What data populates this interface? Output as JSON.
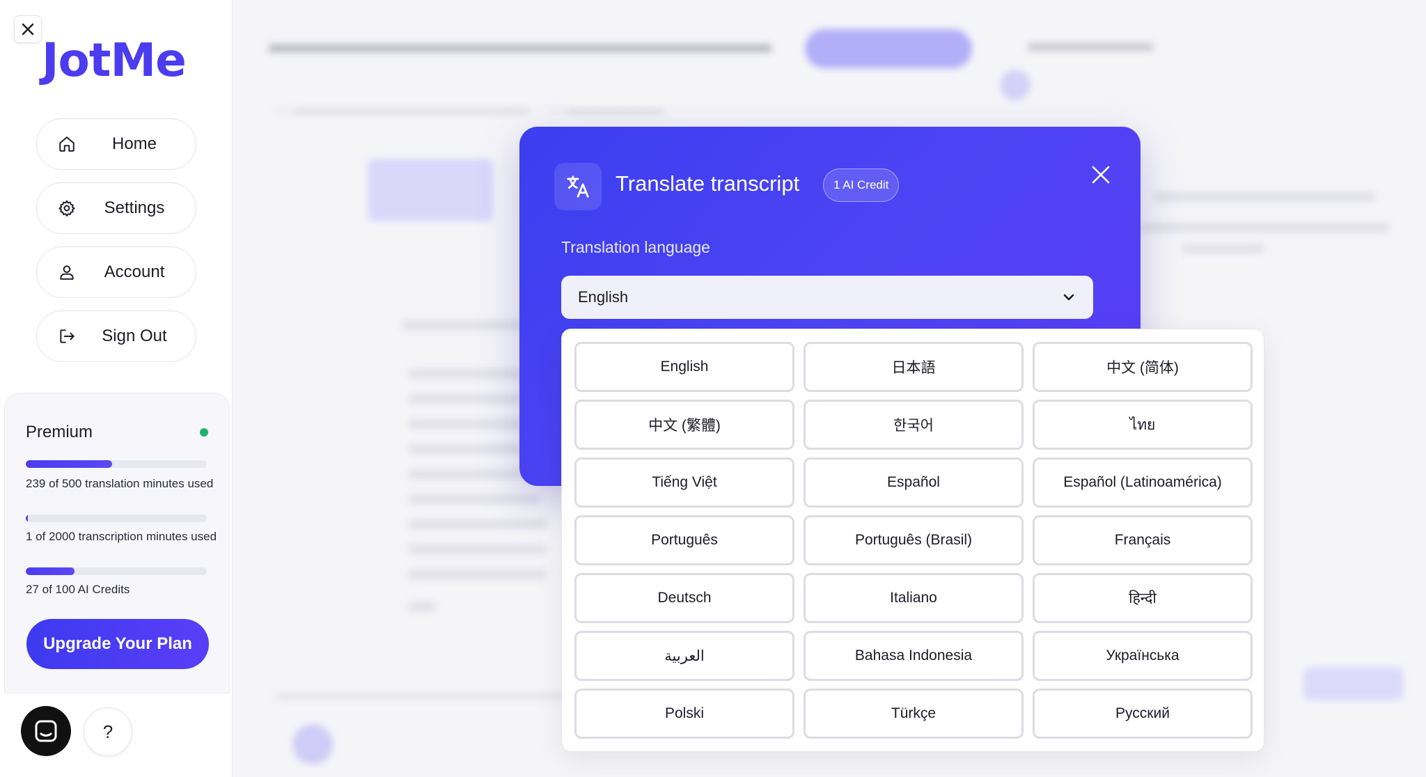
{
  "sidebar": {
    "logo": "JotMe",
    "nav": [
      {
        "label": "Home",
        "icon": "home-icon"
      },
      {
        "label": "Settings",
        "icon": "gear-icon"
      },
      {
        "label": "Account",
        "icon": "user-icon"
      },
      {
        "label": "Sign Out",
        "icon": "sign-out-icon"
      }
    ],
    "plan": {
      "name": "Premium",
      "status_color": "#1db36a",
      "translation": {
        "text": "239 of 500 translation minutes used",
        "used": 239,
        "total": 500
      },
      "transcription": {
        "text": "1 of 2000 transcription minutes used",
        "used": 1,
        "total": 2000
      },
      "credits": {
        "text": "27 of 100 AI Credits",
        "used": 27,
        "total": 100
      },
      "upgrade_label": "Upgrade Your Plan"
    },
    "help_label": "?"
  },
  "modal": {
    "title": "Translate transcript",
    "credit_badge": "1 AI Credit",
    "field_label": "Translation language",
    "selected_language": "English"
  },
  "languages": [
    "English",
    "日本語",
    "中文 (简体)",
    "中文 (繁體)",
    "한국어",
    "ไทย",
    "Tiếng Việt",
    "Español",
    "Español (Latinoamérica)",
    "Português",
    "Português (Brasil)",
    "Français",
    "Deutsch",
    "Italiano",
    "हिन्दी",
    "العربية",
    "Bahasa Indonesia",
    "Українська",
    "Polski",
    "Türkçe",
    "Русский"
  ],
  "colors": {
    "accent": "#4b3cf0",
    "modal_gradient_start": "#3b3ef0",
    "modal_gradient_end": "#5a3cf5"
  }
}
